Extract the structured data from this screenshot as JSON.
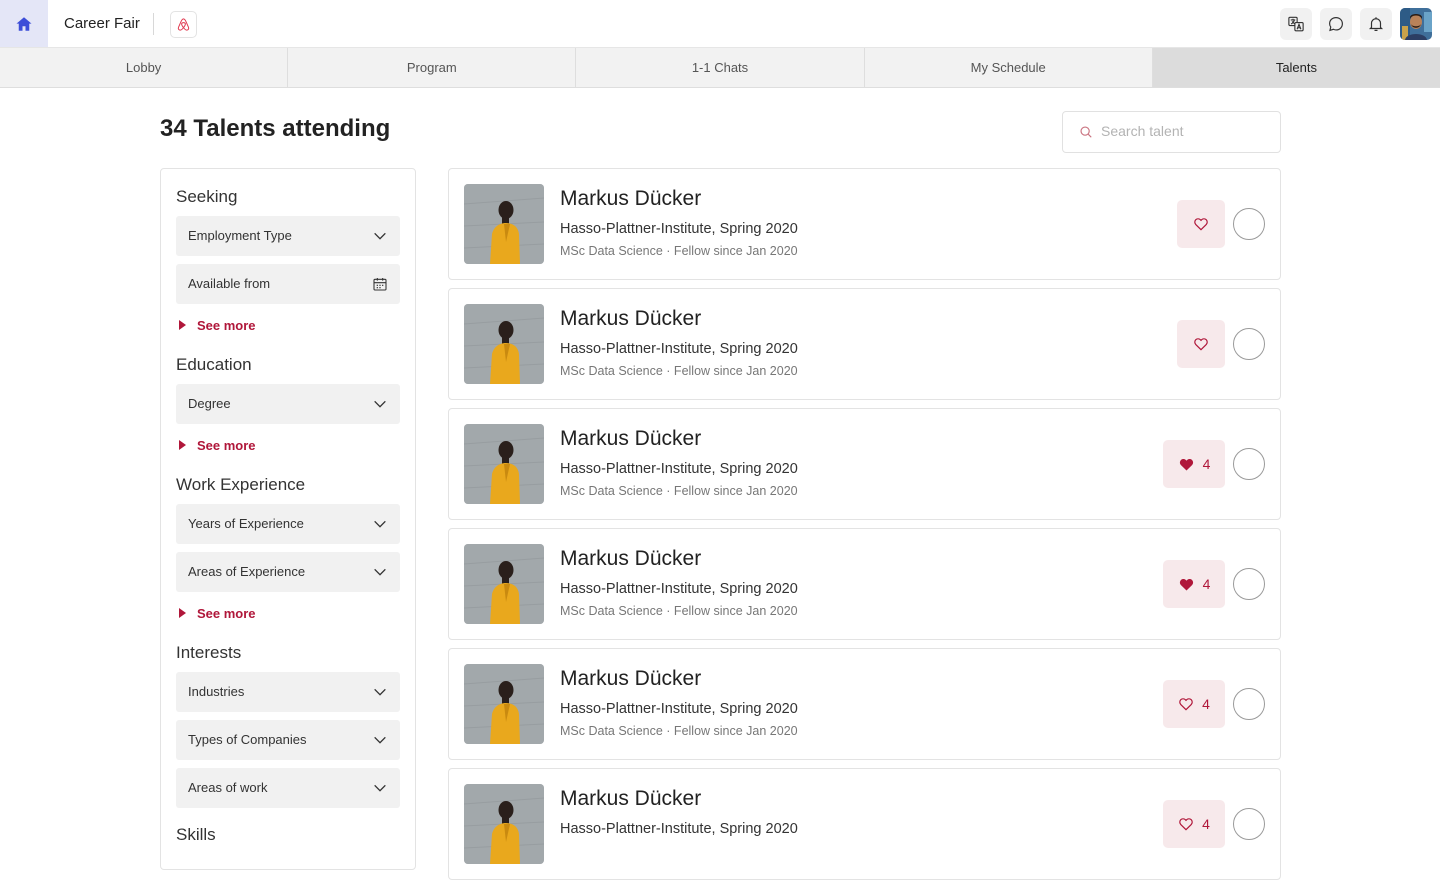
{
  "header": {
    "app_title": "Career Fair",
    "home_icon": "home-icon",
    "brand_icon": "airbnb-logo-icon",
    "actions": [
      "translate-icon",
      "chat-icon",
      "bell-icon"
    ],
    "accent_color": "#3d4ed8"
  },
  "tabs": [
    {
      "label": "Lobby",
      "active": false
    },
    {
      "label": "Program",
      "active": false
    },
    {
      "label": "1-1 Chats",
      "active": false
    },
    {
      "label": "My Schedule",
      "active": false
    },
    {
      "label": "Talents",
      "active": true
    }
  ],
  "page": {
    "title": "34 Talents attending",
    "search_placeholder": "Search talent"
  },
  "filters": {
    "seeking": {
      "title": "Seeking",
      "employment_type": "Employment Type",
      "available_from": "Available from",
      "see_more": "See more"
    },
    "education": {
      "title": "Education",
      "degree": "Degree",
      "see_more": "See more"
    },
    "work_experience": {
      "title": "Work Experience",
      "years": "Years of Experience",
      "areas": "Areas of Experience",
      "see_more": "See more"
    },
    "interests": {
      "title": "Interests",
      "industries": "Industries",
      "company_types": "Types of Companies",
      "areas_of_work": "Areas of work"
    },
    "skills": {
      "title": "Skills"
    }
  },
  "talents": [
    {
      "name": "Markus Dücker",
      "school": "Hasso-Plattner-Institute, Spring 2020",
      "meta": "MSc Data Science · Fellow since Jan 2020",
      "liked": false,
      "likes": ""
    },
    {
      "name": "Markus Dücker",
      "school": "Hasso-Plattner-Institute, Spring 2020",
      "meta": "MSc Data Science · Fellow since Jan 2020",
      "liked": false,
      "likes": ""
    },
    {
      "name": "Markus Dücker",
      "school": "Hasso-Plattner-Institute, Spring 2020",
      "meta": "MSc Data Science · Fellow since Jan 2020",
      "liked": true,
      "likes": "4"
    },
    {
      "name": "Markus Dücker",
      "school": "Hasso-Plattner-Institute, Spring 2020",
      "meta": "MSc Data Science · Fellow since Jan 2020",
      "liked": true,
      "likes": "4"
    },
    {
      "name": "Markus Dücker",
      "school": "Hasso-Plattner-Institute, Spring 2020",
      "meta": "MSc Data Science · Fellow since Jan 2020",
      "liked": false,
      "likes": "4"
    },
    {
      "name": "Markus Dücker",
      "school": "Hasso-Plattner-Institute, Spring 2020",
      "meta": "",
      "liked": false,
      "likes": "4"
    }
  ],
  "colors": {
    "like_accent": "#b0173a",
    "like_bg": "#f7e9eb"
  }
}
